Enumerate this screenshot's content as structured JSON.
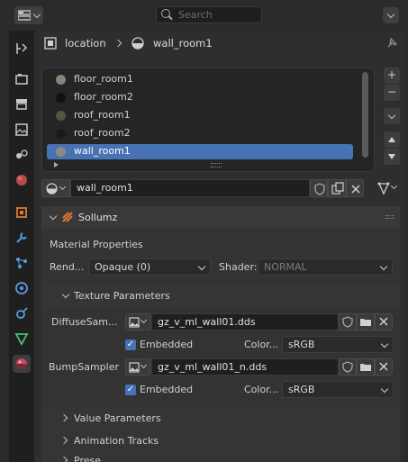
{
  "search": {
    "placeholder": "Search"
  },
  "breadcrumb": {
    "object": "location",
    "material": "wall_room1"
  },
  "material_slots": [
    {
      "name": "floor_room1",
      "color": "#8a8378"
    },
    {
      "name": "floor_room2",
      "color": "#121212"
    },
    {
      "name": "roof_room1",
      "color": "#5a5348"
    },
    {
      "name": "roof_room2",
      "color": "#1a1a1a"
    },
    {
      "name": "wall_room1",
      "color": "#8f8a80",
      "selected": true
    }
  ],
  "side_buttons": {
    "add": "+",
    "remove": "−"
  },
  "material_field": {
    "value": "wall_room1"
  },
  "sollumz": {
    "header": "Sollumz",
    "material_properties_label": "Material Properties",
    "render_label": "Rend...",
    "render_value": "Opaque (0)",
    "shader_label": "Shader:",
    "shader_value": "NORMAL"
  },
  "texture_parameters": {
    "header": "Texture Parameters",
    "rows": [
      {
        "label": "DiffuseSam...",
        "file": "gz_v_ml_wall01.dds",
        "embedded_label": "Embedded",
        "color_label": "Color...",
        "color_value": "sRGB",
        "embedded": true
      },
      {
        "label": "BumpSampler",
        "file": "gz_v_ml_wall01_n.dds",
        "embedded_label": "Embedded",
        "color_label": "Color...",
        "color_value": "sRGB",
        "embedded": true
      }
    ]
  },
  "collapsed_sections": {
    "value_params": "Value Parameters",
    "animation_tracks": "Animation Tracks",
    "partial": "Prese..."
  },
  "colors": {
    "accent": "#4772b3",
    "sollumz_icon": "#e07a2e"
  }
}
